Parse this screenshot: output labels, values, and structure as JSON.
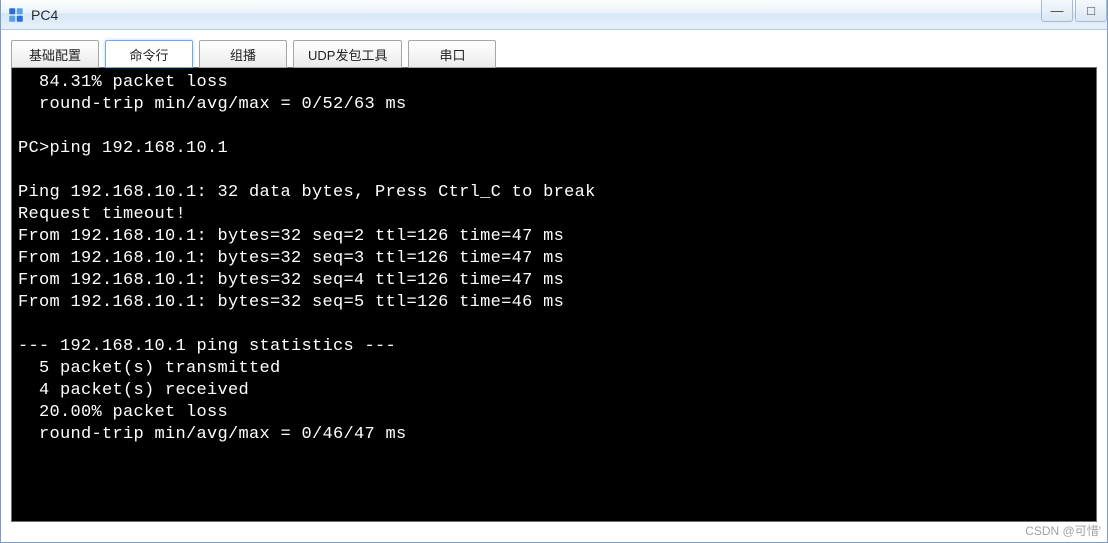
{
  "window": {
    "title": "PC4",
    "controls": {
      "minimize": "—",
      "maximize": "□"
    }
  },
  "tabs": [
    {
      "id": "basic",
      "label": "基础配置"
    },
    {
      "id": "cli",
      "label": "命令行"
    },
    {
      "id": "mcast",
      "label": "组播"
    },
    {
      "id": "udp",
      "label": "UDP发包工具"
    },
    {
      "id": "serial",
      "label": "串口"
    }
  ],
  "active_tab": "cli",
  "terminal_lines": [
    "  84.31% packet loss",
    "  round-trip min/avg/max = 0/52/63 ms",
    "",
    "PC>ping 192.168.10.1",
    "",
    "Ping 192.168.10.1: 32 data bytes, Press Ctrl_C to break",
    "Request timeout!",
    "From 192.168.10.1: bytes=32 seq=2 ttl=126 time=47 ms",
    "From 192.168.10.1: bytes=32 seq=3 ttl=126 time=47 ms",
    "From 192.168.10.1: bytes=32 seq=4 ttl=126 time=47 ms",
    "From 192.168.10.1: bytes=32 seq=5 ttl=126 time=46 ms",
    "",
    "--- 192.168.10.1 ping statistics ---",
    "  5 packet(s) transmitted",
    "  4 packet(s) received",
    "  20.00% packet loss",
    "  round-trip min/avg/max = 0/46/47 ms"
  ],
  "watermark": "CSDN @可惜'"
}
